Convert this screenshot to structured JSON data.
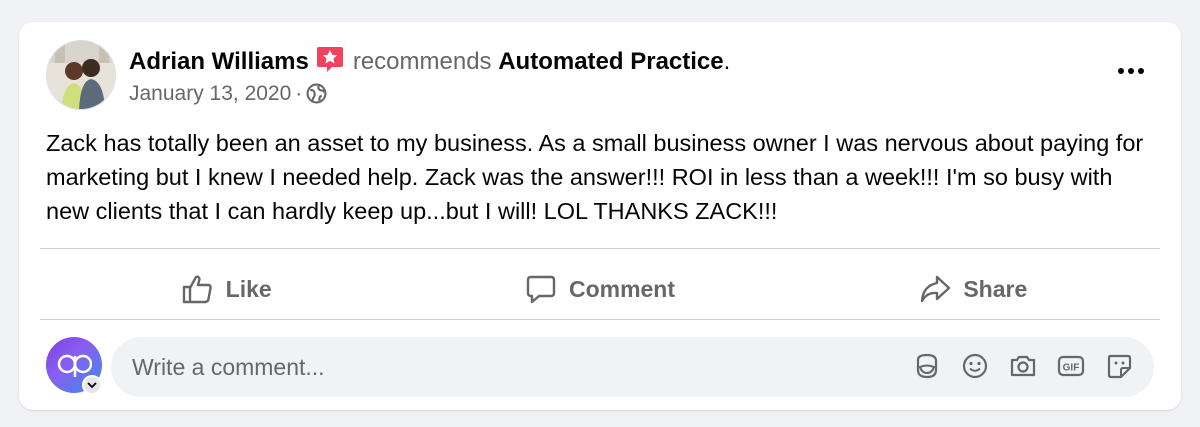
{
  "post": {
    "author_name": "Adrian Williams",
    "verb": "recommends",
    "page_name": "Automated Practice",
    "period": ".",
    "date": "January 13, 2020",
    "separator": "·",
    "privacy_icon": "globe-icon",
    "body": "Zack has totally been an asset to my business. As a small business owner I was nervous about paying for marketing but I knew I needed help. Zack was the answer!!! ROI in less than a week!!! I'm so busy with new clients that I can hardly keep up...but I will! LOL THANKS ZACK!!!"
  },
  "actions": {
    "like_label": "Like",
    "comment_label": "Comment",
    "share_label": "Share"
  },
  "comment_box": {
    "placeholder": "Write a comment...",
    "tools": [
      "avatar-sticker-icon",
      "emoji-icon",
      "camera-icon",
      "gif-icon",
      "sticker-icon"
    ]
  },
  "colors": {
    "badge": "#f3425f",
    "secondary_text": "#65676b",
    "background": "#f0f2f5"
  }
}
